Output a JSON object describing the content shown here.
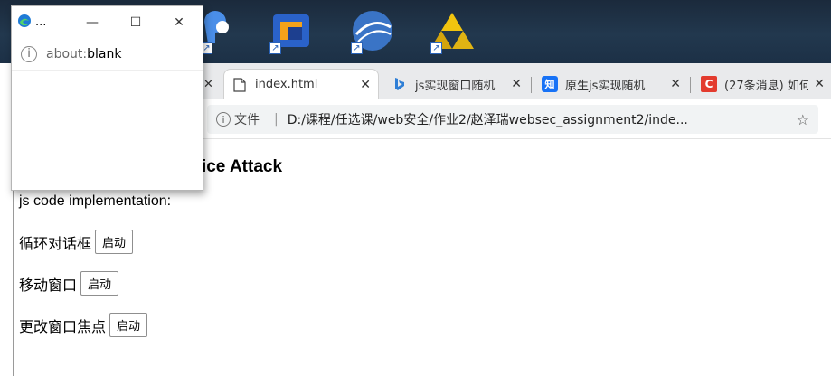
{
  "popup": {
    "app_title": "...",
    "minimize_glyph": "—",
    "maximize_glyph": "☐",
    "close_glyph": "✕",
    "url_scheme": "about:",
    "url_host": "blank"
  },
  "tabs": [
    {
      "title": "index.html",
      "icon": "file-icon",
      "close": "✕",
      "active": true
    },
    {
      "title": "js实现窗口随机",
      "icon": "bing-icon",
      "close": "✕",
      "active": false
    },
    {
      "title": "原生js实现随机",
      "icon": "zhihu-icon",
      "close": "✕",
      "active": false,
      "icon_text": "知"
    },
    {
      "title": "(27条消息) 如何",
      "icon": "csdn-icon",
      "close": "✕",
      "active": false,
      "icon_text": "C"
    }
  ],
  "hidden_tab_close": "✕",
  "address": {
    "label": "文件",
    "url": "D:/课程/任选课/web安全/作业2/赵泽瑞websec_assignment2/inde..."
  },
  "page": {
    "title": "rvice Attack",
    "subtitle": "js code implementation:",
    "rows": [
      {
        "label": "循环对话框",
        "button": "启动"
      },
      {
        "label": "移动窗口",
        "button": "启动"
      },
      {
        "label": "更改窗口焦点",
        "button": "启动"
      }
    ]
  },
  "colors": {
    "edge_blue": "#1f7bd6",
    "bing_blue": "#2f7fd6",
    "zhihu_blue": "#1772f6",
    "csdn_red": "#e33b2e"
  }
}
